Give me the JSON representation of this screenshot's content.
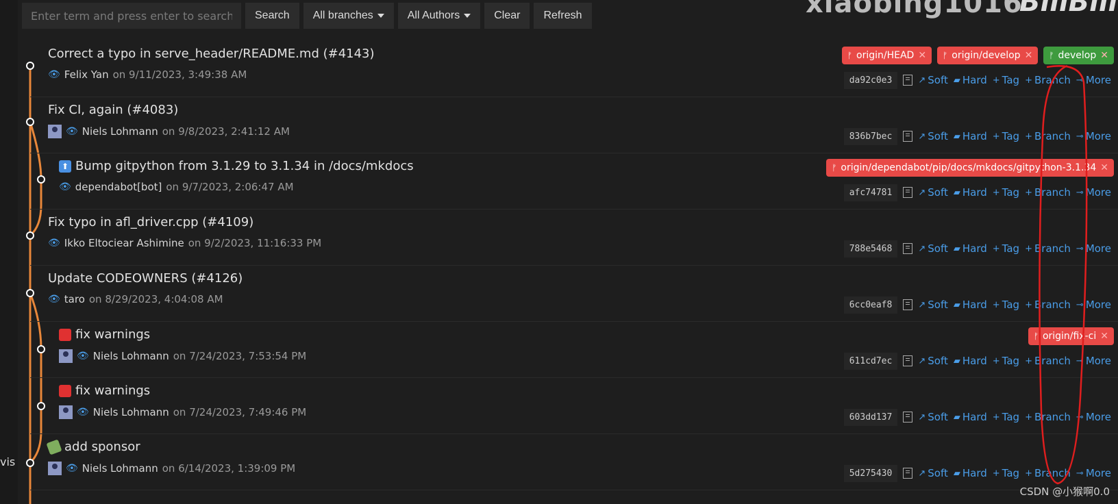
{
  "toolbar": {
    "search_placeholder": "Enter term and press enter to search",
    "search_label": "Search",
    "branches_label": "All branches",
    "authors_label": "All Authors",
    "clear_label": "Clear",
    "refresh_label": "Refresh"
  },
  "watermark": {
    "top_text": "xiaobing1016",
    "logo_text": "BiliBili"
  },
  "left_label": "vis",
  "csdn_watermark": "CSDN @小猴啊0.0",
  "action_labels": {
    "soft": "Soft",
    "hard": "Hard",
    "tag": "Tag",
    "branch": "Branch",
    "more": "More"
  },
  "commits": [
    {
      "message": "Correct a typo in serve_header/README.md (#4143)",
      "author": "Felix Yan",
      "date": "on 9/11/2023, 3:49:38 AM",
      "hash": "da92c0e3",
      "refs": [
        "origin/HEAD",
        "origin/develop",
        "develop"
      ]
    },
    {
      "message": "Fix CI, again (#4083)",
      "author": "Niels Lohmann",
      "date": "on 9/8/2023, 2:41:12 AM",
      "hash": "836b7bec"
    },
    {
      "message": "Bump gitpython from 3.1.29 to 3.1.34 in /docs/mkdocs",
      "author": "dependabot[bot]",
      "date": "on 9/7/2023, 2:06:47 AM",
      "hash": "afc74781",
      "refs": [
        "origin/dependabot/pip/docs/mkdocs/gitpython-3.1.34"
      ]
    },
    {
      "message": "Fix typo in afl_driver.cpp (#4109)",
      "author": "Ikko Eltociear Ashimine",
      "date": "on 9/2/2023, 11:16:33 PM",
      "hash": "788e5468"
    },
    {
      "message": "Update CODEOWNERS (#4126)",
      "author": "taro",
      "date": "on 8/29/2023, 4:04:08 AM",
      "hash": "6cc0eaf8"
    },
    {
      "message": "fix warnings",
      "author": "Niels Lohmann",
      "date": "on 7/24/2023, 7:53:54 PM",
      "hash": "611cd7ec",
      "refs": [
        "origin/fix-ci"
      ]
    },
    {
      "message": "fix warnings",
      "author": "Niels Lohmann",
      "date": "on 7/24/2023, 7:49:46 PM",
      "hash": "603dd137"
    },
    {
      "message": "add sponsor",
      "author": "Niels Lohmann",
      "date": "on 6/14/2023, 1:39:09 PM",
      "hash": "5d275430"
    }
  ],
  "colors": {
    "graph_main": "#e8873a",
    "link": "#4a9de8",
    "ref_red": "#e84a47",
    "ref_green": "#3e9b3e",
    "annotation": "#e01e1e"
  },
  "icons": {
    "eye": "eye-icon",
    "copy": "copy-icon",
    "branch": "branch-icon",
    "close": "close-icon"
  }
}
